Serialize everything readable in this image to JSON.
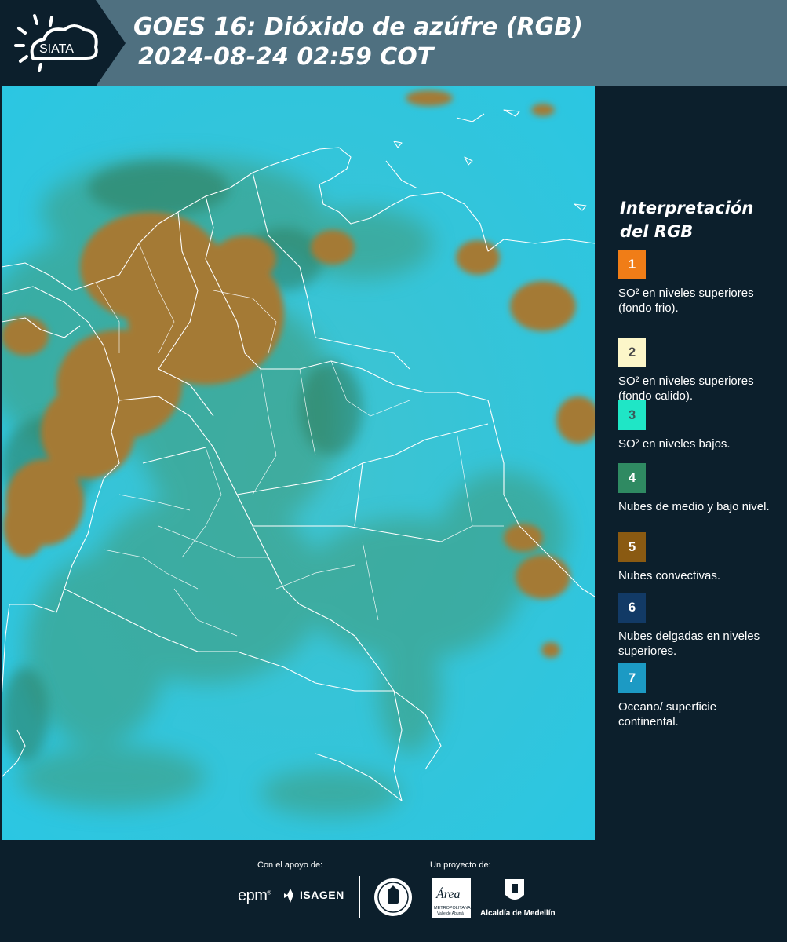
{
  "header": {
    "logo_text": "SIATA",
    "title": "GOES 16: Dióxido de azúfre (RGB)",
    "subtitle": "2024-08-24 02:59 COT"
  },
  "legend": {
    "title": "Interpretación del RGB",
    "items": [
      {
        "number": "1",
        "label": "SO² en niveles superiores (fondo frio).",
        "color": "#f07d17",
        "text_color": "#ffffff"
      },
      {
        "number": "2",
        "label": "SO² en niveles superiores (fondo calido).",
        "color": "#fcf6c9",
        "text_color": "#4a4a4a"
      },
      {
        "number": "3",
        "label": "SO² en niveles bajos.",
        "color": "#1fe6c6",
        "text_color": "#3a5a5a"
      },
      {
        "number": "4",
        "label": "Nubes de medio y bajo nivel.",
        "color": "#2f8a62",
        "text_color": "#ffffff"
      },
      {
        "number": "5",
        "label": "Nubes convectivas.",
        "color": "#8a5a12",
        "text_color": "#ffffff"
      },
      {
        "number": "6",
        "label": "Nubes delgadas en niveles superiores.",
        "color": "#123a66",
        "text_color": "#ffffff"
      },
      {
        "number": "7",
        "label": "Oceano/ superficie continental.",
        "color": "#1c9ac4",
        "text_color": "#ffffff"
      }
    ]
  },
  "footer": {
    "support_label": "Con el apoyo de:",
    "project_label": "Un proyecto de:",
    "epm": "epm",
    "isagen": "ISAGEN",
    "area_text": "Área",
    "area_sub": "METROPOLITANA",
    "area_sub2": "Valle de Aburrá",
    "alcaldia": "Alcaldía de Medellín"
  },
  "colors": {
    "ocean": "#2cc4dd",
    "convective": "#a57a35",
    "mid_low": "#2f8a62",
    "panel_bg": "#0c1f2c",
    "header_band": "#4f7080"
  }
}
